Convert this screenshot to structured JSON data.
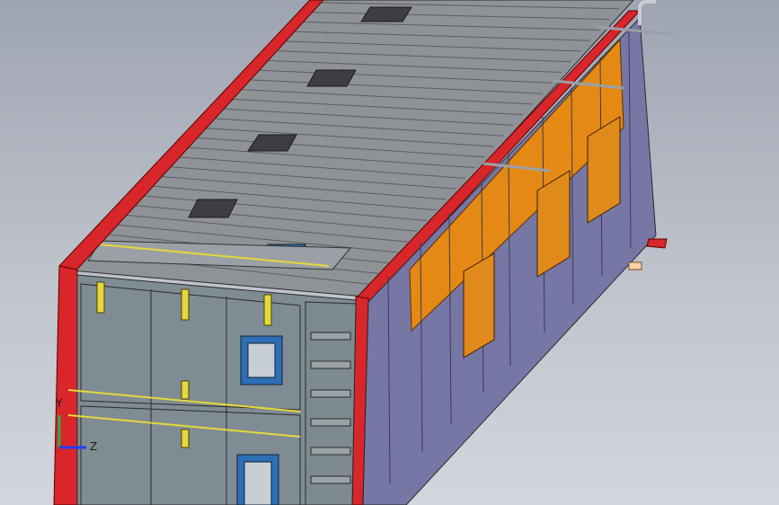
{
  "viewport": {
    "colors": {
      "frame_red": "#d8262a",
      "roof_gray": "#8f9296",
      "wall_gray": "#7f8c93",
      "side_blue": "#7777a6",
      "orange_panel": "#e48a14",
      "hatch_orange": "#e08a1c",
      "vent_blue": "#2d6fb4",
      "latch_yellow": "#e6d83a",
      "rod_gray": "#9aa0a8"
    },
    "triad": {
      "y_label": "Y",
      "z_label": "Z",
      "x_axis_color": "#d22222",
      "y_axis_color": "#22b14c",
      "z_axis_color": "#1e3cff"
    }
  }
}
